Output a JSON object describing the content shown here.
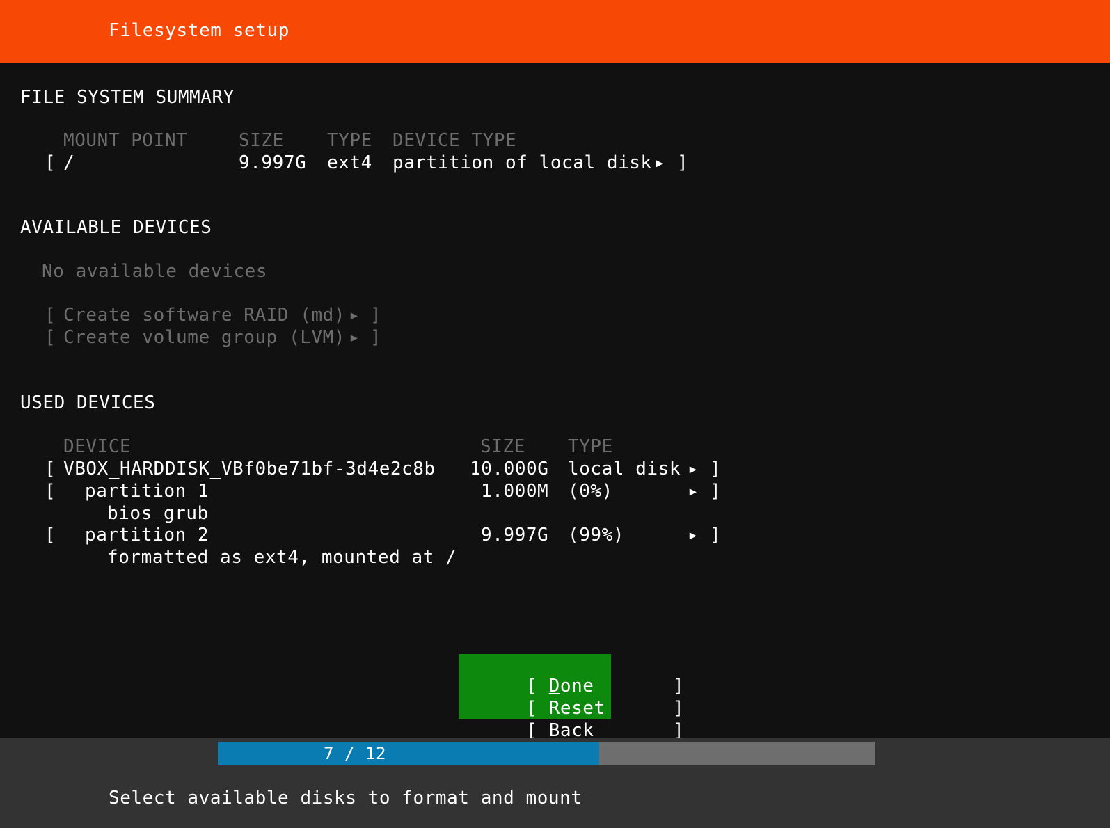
{
  "header": {
    "title": "Filesystem setup"
  },
  "filesystem_summary": {
    "section_title": "FILE SYSTEM SUMMARY",
    "columns": {
      "mount_point": "MOUNT POINT",
      "size": "SIZE",
      "type": "TYPE",
      "device_type": "DEVICE TYPE"
    },
    "rows": [
      {
        "open_bracket": "[",
        "mount_point": "/",
        "size": "9.997G",
        "type": "ext4",
        "device_type": "partition of local disk",
        "arrow": "▸",
        "close_bracket": "]"
      }
    ]
  },
  "available_devices": {
    "section_title": "AVAILABLE DEVICES",
    "empty_message": "No available devices",
    "actions": [
      {
        "open_bracket": "[",
        "label": "Create software RAID (md)",
        "arrow": "▸",
        "close_bracket": "]",
        "enabled": false
      },
      {
        "open_bracket": "[",
        "label": "Create volume group (LVM)",
        "arrow": "▸",
        "close_bracket": "]",
        "enabled": false
      }
    ]
  },
  "used_devices": {
    "section_title": "USED DEVICES",
    "columns": {
      "device": "DEVICE",
      "size": "SIZE",
      "type": "TYPE"
    },
    "rows": [
      {
        "open_bracket": "[",
        "device": "VBOX_HARDDISK_VBf0be71bf-3d4e2c8b",
        "size": "10.000G",
        "type": "local disk",
        "arrow": "▸",
        "close_bracket": "]",
        "detail": ""
      },
      {
        "open_bracket": "[",
        "device": "partition 1",
        "size": "1.000M",
        "type": "(0%)",
        "arrow": "▸",
        "close_bracket": "]",
        "detail": "bios_grub"
      },
      {
        "open_bracket": "[",
        "device": "partition 2",
        "size": "9.997G",
        "type": "(99%)",
        "arrow": "▸",
        "close_bracket": "]",
        "detail": "formatted as ext4, mounted at /"
      }
    ]
  },
  "buttons": [
    {
      "open_bracket": "[",
      "label": "Done",
      "accel": "D",
      "rest": "one",
      "close_bracket": "]",
      "selected": true
    },
    {
      "open_bracket": "[",
      "label": "Reset",
      "accel": "R",
      "rest": "eset",
      "close_bracket": "]",
      "selected": false
    },
    {
      "open_bracket": "[",
      "label": "Back",
      "accel": "B",
      "rest": "ack",
      "close_bracket": "]",
      "selected": false
    }
  ],
  "footer": {
    "progress_label": "7 / 12",
    "progress_current": 7,
    "progress_total": 12,
    "progress_percent": 58,
    "hint": "Select available disks to format and mount"
  },
  "colors": {
    "header_orange": "#f74806",
    "background": "#111111",
    "selected_green": "#0d8a0d",
    "progress_blue": "#0a7cb2",
    "progress_track_gray": "#6e6e6e",
    "footer_gray": "#333333",
    "dim_text": "#6d6d6d",
    "bright_text": "#ffffff"
  }
}
